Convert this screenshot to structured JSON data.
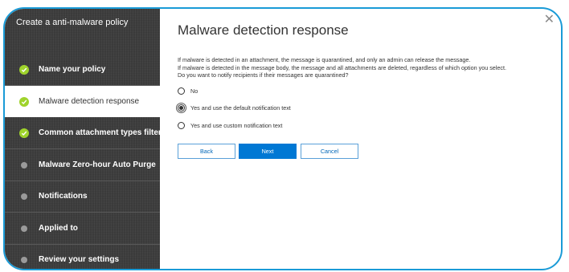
{
  "sidebar": {
    "title": "Create a anti-malware policy",
    "steps": [
      {
        "label": "Name your policy",
        "state": "done"
      },
      {
        "label": "Malware detection response",
        "state": "active"
      },
      {
        "label": "Common attachment types filter",
        "state": "done"
      },
      {
        "label": "Malware Zero-hour Auto Purge",
        "state": "todo"
      },
      {
        "label": "Notifications",
        "state": "todo"
      },
      {
        "label": "Applied to",
        "state": "todo"
      },
      {
        "label": "Review your settings",
        "state": "todo"
      }
    ]
  },
  "main": {
    "title": "Malware detection response",
    "description": [
      "If malware is detected in an attachment, the message is quarantined, and only an admin can release the message.",
      "If malware is detected in the message body, the message and all attachments are deleted, regardless of which option you select.",
      "Do you want to notify recipients if their messages are quarantined?"
    ],
    "options": [
      {
        "label": "No",
        "selected": false
      },
      {
        "label": "Yes and use the default notification text",
        "selected": true
      },
      {
        "label": "Yes and use custom notification text",
        "selected": false
      }
    ],
    "buttons": {
      "back": "Back",
      "next": "Next",
      "cancel": "Cancel"
    }
  },
  "icons": {
    "close": "close-icon",
    "check": "check-icon"
  },
  "colors": {
    "accent": "#0078d4",
    "done": "#9fd32c",
    "sidebar": "#3d3d3d",
    "frame": "#1a9bd7"
  }
}
